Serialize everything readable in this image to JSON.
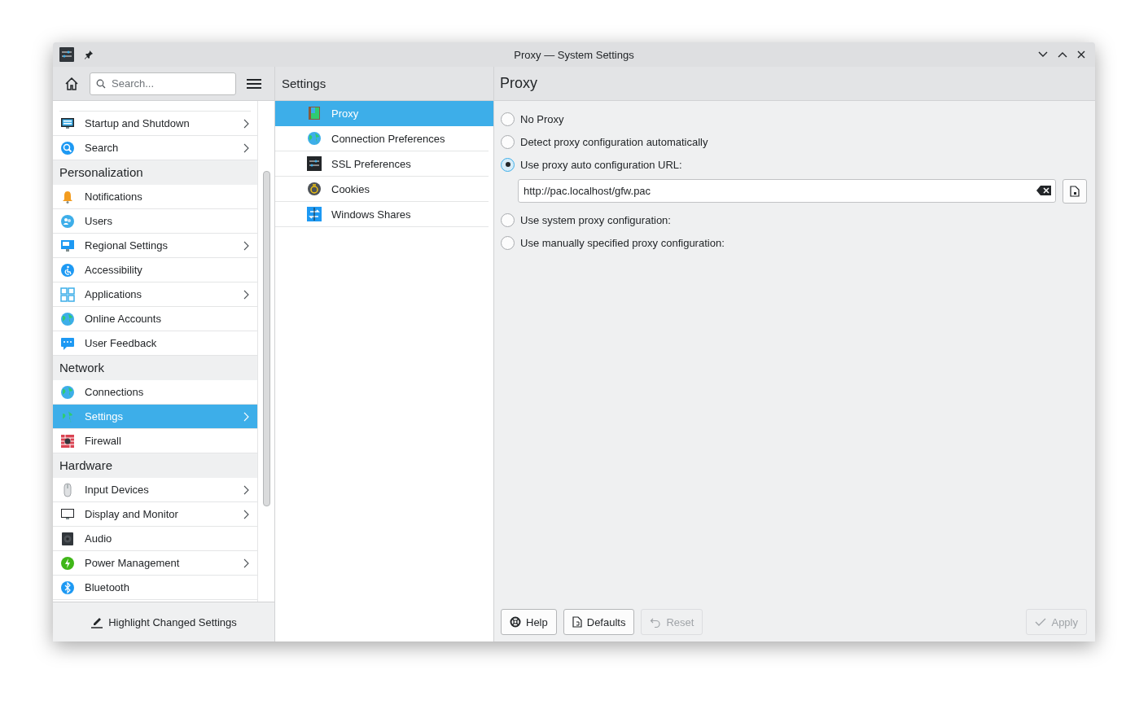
{
  "window": {
    "title": "Proxy — System Settings"
  },
  "sidebar": {
    "search": {
      "placeholder": "Search..."
    },
    "items": [
      {
        "kind": "item",
        "label": "Startup and Shutdown",
        "chevron": true,
        "selected": false
      },
      {
        "kind": "item",
        "label": "Search",
        "chevron": true,
        "selected": false
      },
      {
        "kind": "category",
        "label": "Personalization"
      },
      {
        "kind": "item",
        "label": "Notifications",
        "chevron": false,
        "selected": false
      },
      {
        "kind": "item",
        "label": "Users",
        "chevron": false,
        "selected": false
      },
      {
        "kind": "item",
        "label": "Regional Settings",
        "chevron": true,
        "selected": false
      },
      {
        "kind": "item",
        "label": "Accessibility",
        "chevron": false,
        "selected": false
      },
      {
        "kind": "item",
        "label": "Applications",
        "chevron": true,
        "selected": false
      },
      {
        "kind": "item",
        "label": "Online Accounts",
        "chevron": false,
        "selected": false
      },
      {
        "kind": "item",
        "label": "User Feedback",
        "chevron": false,
        "selected": false
      },
      {
        "kind": "category",
        "label": "Network"
      },
      {
        "kind": "item",
        "label": "Connections",
        "chevron": false,
        "selected": false
      },
      {
        "kind": "item",
        "label": "Settings",
        "chevron": true,
        "selected": true
      },
      {
        "kind": "item",
        "label": "Firewall",
        "chevron": false,
        "selected": false
      },
      {
        "kind": "category",
        "label": "Hardware"
      },
      {
        "kind": "item",
        "label": "Input Devices",
        "chevron": true,
        "selected": false
      },
      {
        "kind": "item",
        "label": "Display and Monitor",
        "chevron": true,
        "selected": false
      },
      {
        "kind": "item",
        "label": "Audio",
        "chevron": false,
        "selected": false
      },
      {
        "kind": "item",
        "label": "Power Management",
        "chevron": true,
        "selected": false
      },
      {
        "kind": "item",
        "label": "Bluetooth",
        "chevron": false,
        "selected": false
      }
    ],
    "footer": "Highlight Changed Settings"
  },
  "middle": {
    "title": "Settings",
    "items": [
      {
        "label": "Proxy",
        "selected": true
      },
      {
        "label": "Connection Preferences",
        "selected": false
      },
      {
        "label": "SSL Preferences",
        "selected": false
      },
      {
        "label": "Cookies",
        "selected": false
      },
      {
        "label": "Windows Shares",
        "selected": false
      }
    ]
  },
  "content": {
    "title": "Proxy",
    "options": [
      {
        "label": "No Proxy",
        "selected": false
      },
      {
        "label": "Detect proxy configuration automatically",
        "selected": false
      },
      {
        "label": "Use proxy auto configuration URL:",
        "selected": true
      },
      {
        "label": "Use system proxy configuration:",
        "selected": false
      },
      {
        "label": "Use manually specified proxy configuration:",
        "selected": false
      }
    ],
    "url": "http://pac.localhost/gfw.pac",
    "buttons": [
      {
        "label": "Help",
        "disabled": false
      },
      {
        "label": "Defaults",
        "disabled": false
      },
      {
        "label": "Reset",
        "disabled": true
      },
      {
        "label": "Apply",
        "disabled": true
      }
    ]
  }
}
